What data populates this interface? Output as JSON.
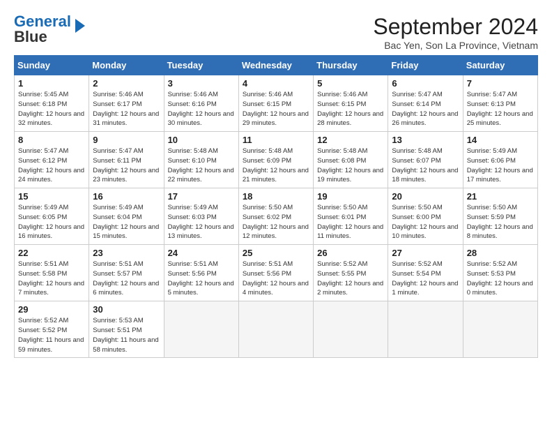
{
  "header": {
    "logo_line1": "General",
    "logo_line2": "Blue",
    "title": "September 2024",
    "subtitle": "Bac Yen, Son La Province, Vietnam"
  },
  "days_of_week": [
    "Sunday",
    "Monday",
    "Tuesday",
    "Wednesday",
    "Thursday",
    "Friday",
    "Saturday"
  ],
  "weeks": [
    [
      {
        "day": 1,
        "sunrise": "5:45 AM",
        "sunset": "6:18 PM",
        "daylight": "12 hours and 32 minutes."
      },
      {
        "day": 2,
        "sunrise": "5:46 AM",
        "sunset": "6:17 PM",
        "daylight": "12 hours and 31 minutes."
      },
      {
        "day": 3,
        "sunrise": "5:46 AM",
        "sunset": "6:16 PM",
        "daylight": "12 hours and 30 minutes."
      },
      {
        "day": 4,
        "sunrise": "5:46 AM",
        "sunset": "6:15 PM",
        "daylight": "12 hours and 29 minutes."
      },
      {
        "day": 5,
        "sunrise": "5:46 AM",
        "sunset": "6:15 PM",
        "daylight": "12 hours and 28 minutes."
      },
      {
        "day": 6,
        "sunrise": "5:47 AM",
        "sunset": "6:14 PM",
        "daylight": "12 hours and 26 minutes."
      },
      {
        "day": 7,
        "sunrise": "5:47 AM",
        "sunset": "6:13 PM",
        "daylight": "12 hours and 25 minutes."
      }
    ],
    [
      {
        "day": 8,
        "sunrise": "5:47 AM",
        "sunset": "6:12 PM",
        "daylight": "12 hours and 24 minutes."
      },
      {
        "day": 9,
        "sunrise": "5:47 AM",
        "sunset": "6:11 PM",
        "daylight": "12 hours and 23 minutes."
      },
      {
        "day": 10,
        "sunrise": "5:48 AM",
        "sunset": "6:10 PM",
        "daylight": "12 hours and 22 minutes."
      },
      {
        "day": 11,
        "sunrise": "5:48 AM",
        "sunset": "6:09 PM",
        "daylight": "12 hours and 21 minutes."
      },
      {
        "day": 12,
        "sunrise": "5:48 AM",
        "sunset": "6:08 PM",
        "daylight": "12 hours and 19 minutes."
      },
      {
        "day": 13,
        "sunrise": "5:48 AM",
        "sunset": "6:07 PM",
        "daylight": "12 hours and 18 minutes."
      },
      {
        "day": 14,
        "sunrise": "5:49 AM",
        "sunset": "6:06 PM",
        "daylight": "12 hours and 17 minutes."
      }
    ],
    [
      {
        "day": 15,
        "sunrise": "5:49 AM",
        "sunset": "6:05 PM",
        "daylight": "12 hours and 16 minutes."
      },
      {
        "day": 16,
        "sunrise": "5:49 AM",
        "sunset": "6:04 PM",
        "daylight": "12 hours and 15 minutes."
      },
      {
        "day": 17,
        "sunrise": "5:49 AM",
        "sunset": "6:03 PM",
        "daylight": "12 hours and 13 minutes."
      },
      {
        "day": 18,
        "sunrise": "5:50 AM",
        "sunset": "6:02 PM",
        "daylight": "12 hours and 12 minutes."
      },
      {
        "day": 19,
        "sunrise": "5:50 AM",
        "sunset": "6:01 PM",
        "daylight": "12 hours and 11 minutes."
      },
      {
        "day": 20,
        "sunrise": "5:50 AM",
        "sunset": "6:00 PM",
        "daylight": "12 hours and 10 minutes."
      },
      {
        "day": 21,
        "sunrise": "5:50 AM",
        "sunset": "5:59 PM",
        "daylight": "12 hours and 8 minutes."
      }
    ],
    [
      {
        "day": 22,
        "sunrise": "5:51 AM",
        "sunset": "5:58 PM",
        "daylight": "12 hours and 7 minutes."
      },
      {
        "day": 23,
        "sunrise": "5:51 AM",
        "sunset": "5:57 PM",
        "daylight": "12 hours and 6 minutes."
      },
      {
        "day": 24,
        "sunrise": "5:51 AM",
        "sunset": "5:56 PM",
        "daylight": "12 hours and 5 minutes."
      },
      {
        "day": 25,
        "sunrise": "5:51 AM",
        "sunset": "5:56 PM",
        "daylight": "12 hours and 4 minutes."
      },
      {
        "day": 26,
        "sunrise": "5:52 AM",
        "sunset": "5:55 PM",
        "daylight": "12 hours and 2 minutes."
      },
      {
        "day": 27,
        "sunrise": "5:52 AM",
        "sunset": "5:54 PM",
        "daylight": "12 hours and 1 minute."
      },
      {
        "day": 28,
        "sunrise": "5:52 AM",
        "sunset": "5:53 PM",
        "daylight": "12 hours and 0 minutes."
      }
    ],
    [
      {
        "day": 29,
        "sunrise": "5:52 AM",
        "sunset": "5:52 PM",
        "daylight": "11 hours and 59 minutes."
      },
      {
        "day": 30,
        "sunrise": "5:53 AM",
        "sunset": "5:51 PM",
        "daylight": "11 hours and 58 minutes."
      },
      null,
      null,
      null,
      null,
      null
    ]
  ]
}
